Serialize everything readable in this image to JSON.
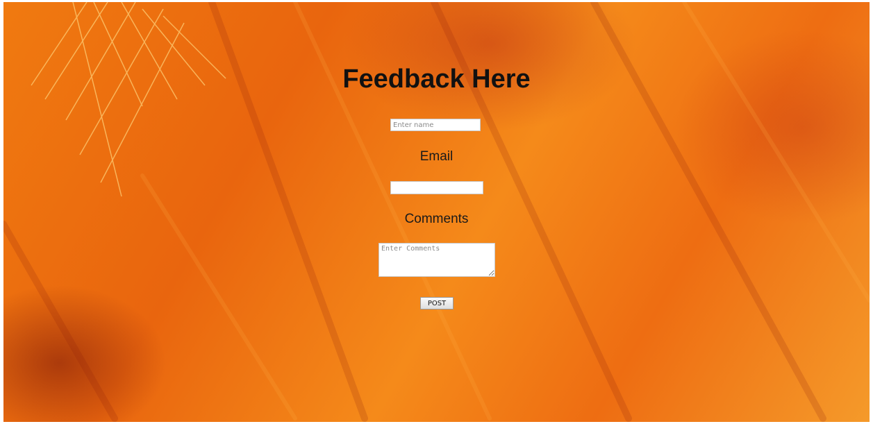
{
  "page": {
    "background_colors": [
      "#f07a10",
      "#e9650e",
      "#f58a1a",
      "#b8321a"
    ]
  },
  "form": {
    "title": "Feedback Here",
    "name_placeholder": "Enter name",
    "email_label": "Email",
    "email_value": "",
    "comments_label": "Comments",
    "comments_placeholder": "Enter Comments",
    "submit_label": "POST"
  }
}
